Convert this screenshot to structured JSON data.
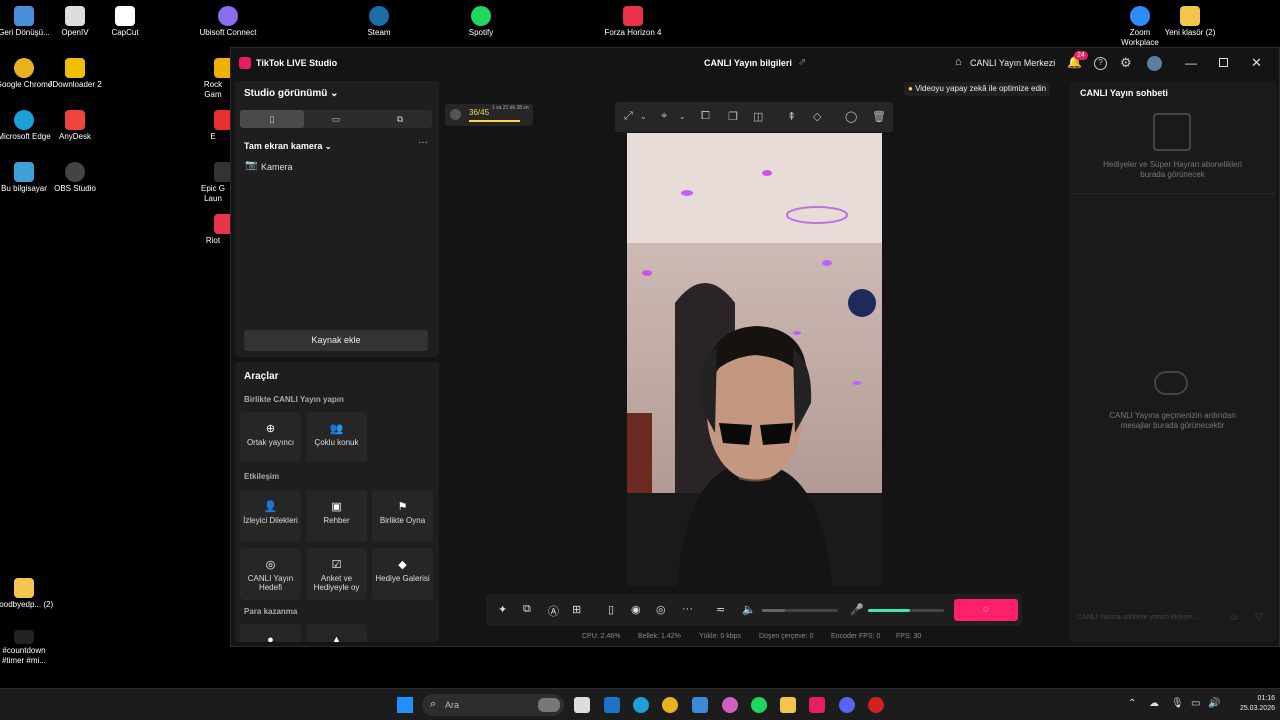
{
  "desktop": {
    "icons": [
      {
        "label": "Geri Dönüşü...",
        "color": "#4a90d9"
      },
      {
        "label": "OpenIV",
        "color": "#dddddd"
      },
      {
        "label": "CapCut",
        "color": "#ffffff"
      },
      {
        "label": "Ubisoft Connect",
        "color": "#8a6cf0"
      },
      {
        "label": "Steam",
        "color": "#1b6fa8"
      },
      {
        "label": "Spotify",
        "color": "#1ed760"
      },
      {
        "label": "Forza Horizon 4",
        "color": "#e8334a"
      },
      {
        "label": "Zoom Workplace",
        "color": "#2d8cff"
      },
      {
        "label": "Yeni klasör (2)",
        "color": "#f3c54c"
      },
      {
        "label": "Google Chrome",
        "color": "#e8b31e"
      },
      {
        "label": "JDownloader 2",
        "color": "#f0c000"
      },
      {
        "label": "Microsoft Edge",
        "color": "#1fa0d8"
      },
      {
        "label": "AnyDesk",
        "color": "#ef443b"
      },
      {
        "label": "Bu bilgisayar",
        "color": "#3fa0d8"
      },
      {
        "label": "OBS Studio",
        "color": "#444444"
      },
      {
        "label": "goodbyedp... (2)",
        "color": "#f3c54c"
      },
      {
        "label": "#countdown #timer #mi...",
        "color": "#222222"
      }
    ],
    "partial_icons": [
      "Rock Gam",
      "E",
      "Epic G Laun",
      "Riot"
    ]
  },
  "titlebar": {
    "app_name": "TikTok LIVE Studio",
    "center_title": "CANLI Yayın bilgileri",
    "merkezi_label": "CANLI Yayın Merkezi",
    "notif_count": "24"
  },
  "left": {
    "title": "Studio görünümü",
    "scene_label": "Tam ekran kamera",
    "source_camera": "Kamera",
    "add_source": "Kaynak ekle",
    "tools_title": "Araçlar",
    "sections": {
      "together": "Birlikte CANLI Yayın yapın",
      "engagement": "Etkileşim",
      "monetize": "Para kazanma"
    },
    "tools_together": [
      "Ortak yayıncı",
      "Çoklu konuk"
    ],
    "tools_engagement": [
      "İzleyici Dilekleri",
      "Rehber",
      "Birlikte Oyna",
      "CANLI Yayın Hedefi",
      "Anket ve Hediyeyle oy",
      "Hediye Galerisi"
    ]
  },
  "preview": {
    "viewer_count": "36/45",
    "timer": "1 sa 21 dk 38 sn",
    "progress": 0.8,
    "ai_tip": "Videoyu yapay zekâ ile optimize edin",
    "volume_level": 0.3,
    "mic_level": 0.55
  },
  "stats": {
    "cpu": "CPU:  2.46%",
    "memory": "Bellek:  1.42%",
    "upload": "Yükle:  0 kbps",
    "dropped": "Düşen çerçeve:  0",
    "encoder_fps": "Encoder FPS:  0",
    "fps": "FPS:  30"
  },
  "chat": {
    "title": "CANLI Yayın sohbeti",
    "gifts_empty": "Hediyeler ve Süper Hayran abonelikleri burada görünecek",
    "messages_empty": "CANLI Yayına geçmenizin ardından mesajlar burada görünecektir",
    "input_placeholder": "CANLI Yayına sohbete yorum ekleyin..."
  },
  "taskbar": {
    "search_placeholder": "Ara",
    "time": "01:16",
    "date": "25.03.2026"
  }
}
